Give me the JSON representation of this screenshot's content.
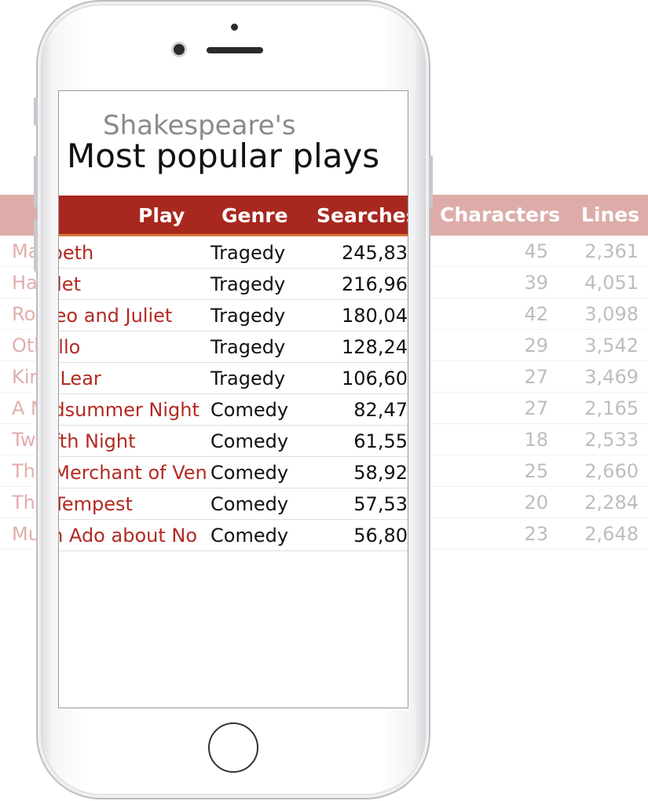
{
  "page": {
    "subtitle": "Shakespeare's",
    "title": "Most popular plays"
  },
  "table": {
    "headers": {
      "play": "Play",
      "genre": "Genre",
      "searches": "Searches",
      "characters": "Characters",
      "lines": "Lines"
    },
    "rows": [
      {
        "play": "Macbeth",
        "genre": "Tragedy",
        "searches": "245,83",
        "characters": "45",
        "lines": "2,361"
      },
      {
        "play": "Hamlet",
        "genre": "Tragedy",
        "searches": "216,96",
        "characters": "39",
        "lines": "4,051"
      },
      {
        "play": "Romeo and Juliet",
        "genre": "Tragedy",
        "searches": "180,04",
        "characters": "42",
        "lines": "3,098"
      },
      {
        "play": "Othello",
        "genre": "Tragedy",
        "searches": "128,24",
        "characters": "29",
        "lines": "3,542"
      },
      {
        "play": "King Lear",
        "genre": "Tragedy",
        "searches": "106,60",
        "characters": "27",
        "lines": "3,469"
      },
      {
        "play": "A Midsummer Night",
        "genre": "Comedy",
        "searches": "82,47",
        "characters": "27",
        "lines": "2,165"
      },
      {
        "play": "Twelfth Night",
        "genre": "Comedy",
        "searches": "61,55",
        "characters": "18",
        "lines": "2,533"
      },
      {
        "play": "The Merchant of Ven",
        "genre": "Comedy",
        "searches": "58,92",
        "characters": "25",
        "lines": "2,660"
      },
      {
        "play": "The Tempest",
        "genre": "Comedy",
        "searches": "57,53",
        "characters": "20",
        "lines": "2,284"
      },
      {
        "play": "Much Ado about No",
        "genre": "Comedy",
        "searches": "56,80",
        "characters": "23",
        "lines": "2,648"
      }
    ]
  },
  "colors": {
    "header_bg": "#a8281f",
    "header_underline": "#d87838",
    "play_link": "#b22a22"
  },
  "icons": [
    "front-camera-icon",
    "speaker-icon",
    "home-button-icon"
  ]
}
